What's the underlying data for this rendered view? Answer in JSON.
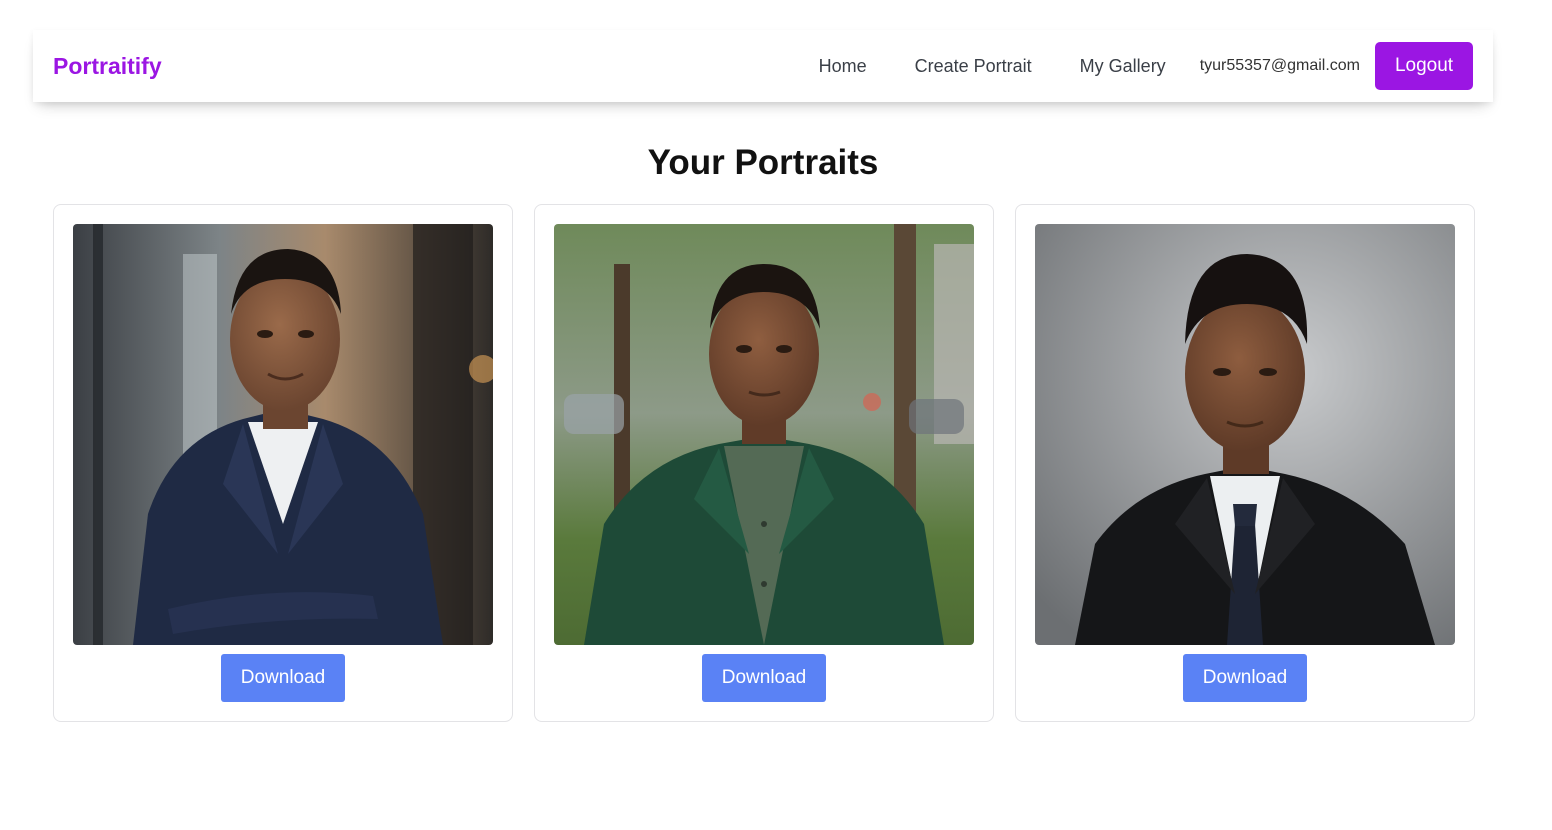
{
  "header": {
    "brand": "Portraitify",
    "nav": [
      "Home",
      "Create Portrait",
      "My Gallery"
    ],
    "user_email": "tyur55357@gmail.com",
    "logout_label": "Logout"
  },
  "page": {
    "title": "Your Portraits"
  },
  "portraits": [
    {
      "download_label": "Download"
    },
    {
      "download_label": "Download"
    },
    {
      "download_label": "Download"
    }
  ],
  "colors": {
    "brand": "#9b16e3",
    "download": "#5a82f5"
  }
}
